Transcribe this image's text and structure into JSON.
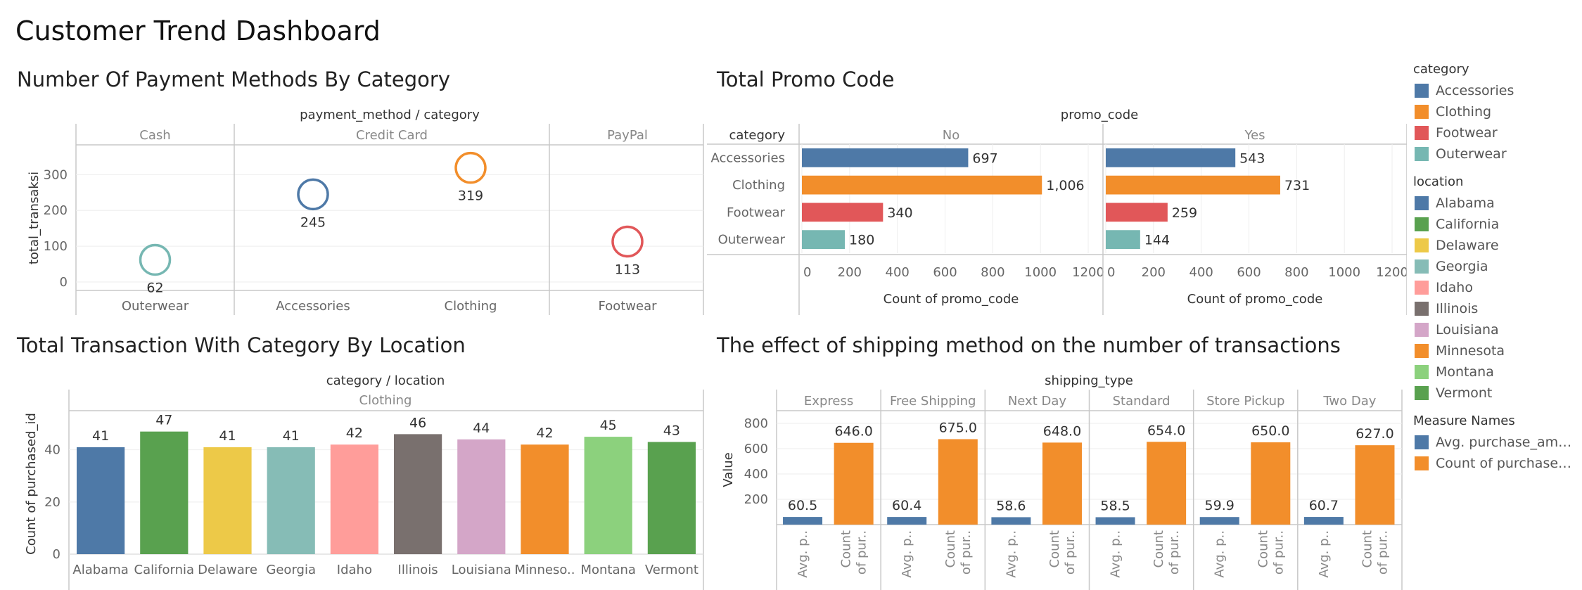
{
  "dashboard": {
    "title": "Customer Trend Dashboard"
  },
  "colors": {
    "Accessories": "#4e79a7",
    "Clothing": "#f28e2b",
    "Footwear": "#e15759",
    "Outerwear": "#76b7b2",
    "Alabama": "#4e79a7",
    "California": "#59a14f",
    "Delaware": "#edc948",
    "Georgia": "#86bcb6",
    "Idaho": "#ff9d9a",
    "Illinois": "#79706e",
    "Louisiana": "#d4a6c8",
    "Minnesota": "#f28e2b",
    "Montana": "#8cd17d",
    "Vermont": "#59a14f",
    "Avg. purchase_amou..": "#4e79a7",
    "Count of purchased_i..": "#f28e2b"
  },
  "chart_data": [
    {
      "type": "scatter",
      "title": "Number Of Payment Methods By Category",
      "header": "payment_method / category",
      "ylabel": "total_transaksi",
      "ylim": [
        0,
        380
      ],
      "yticks": [
        0,
        100,
        200,
        300
      ],
      "panels": [
        {
          "payment_method": "Cash",
          "categories": [
            "Outerwear"
          ],
          "values": [
            62
          ]
        },
        {
          "payment_method": "Credit Card",
          "categories": [
            "Accessories",
            "Clothing"
          ],
          "values": [
            245,
            319
          ]
        },
        {
          "payment_method": "PayPal",
          "categories": [
            "Footwear"
          ],
          "values": [
            113
          ]
        }
      ],
      "grid": true
    },
    {
      "type": "bar",
      "title": "Total Promo Code",
      "header": "promo_code",
      "row_header": "category",
      "categories": [
        "Accessories",
        "Clothing",
        "Footwear",
        "Outerwear"
      ],
      "panels": [
        {
          "name": "No",
          "values": [
            697,
            1006,
            340,
            180
          ],
          "labels": [
            "697",
            "1,006",
            "340",
            "180"
          ]
        },
        {
          "name": "Yes",
          "values": [
            543,
            731,
            259,
            144
          ],
          "labels": [
            "543",
            "731",
            "259",
            "144"
          ]
        }
      ],
      "xlabel": "Count of promo_code",
      "xlim": [
        0,
        1250
      ],
      "xticks": [
        0,
        200,
        400,
        600,
        800,
        1000,
        1200
      ]
    },
    {
      "type": "bar",
      "title": "Total Transaction With Category By Location",
      "header": "category / location",
      "subheader": "Clothing",
      "categories": [
        "Alabama",
        "California",
        "Delaware",
        "Georgia",
        "Idaho",
        "Illinois",
        "Louisiana",
        "Minnesota",
        "Montana",
        "Vermont"
      ],
      "tick_labels": [
        "Alabama",
        "California",
        "Delaware",
        "Georgia",
        "Idaho",
        "Illinois",
        "Louisiana",
        "Minneso..",
        "Montana",
        "Vermont"
      ],
      "values": [
        41,
        47,
        41,
        41,
        42,
        46,
        44,
        42,
        45,
        43
      ],
      "ylabel": "Count of purchased_id",
      "ylim": [
        0,
        55
      ],
      "yticks": [
        0,
        20,
        40
      ]
    },
    {
      "type": "bar",
      "title": "The effect of shipping method on the number of transactions",
      "header": "shipping_type",
      "ylabel": "Value",
      "ylim": [
        0,
        900
      ],
      "yticks": [
        200,
        400,
        600,
        800
      ],
      "panels": [
        "Express",
        "Free Shipping",
        "Next Day",
        "Standard",
        "Store Pickup",
        "Two Day"
      ],
      "measure_tick_labels": [
        [
          "Avg. p.."
        ],
        [
          "Count",
          "of pur.."
        ]
      ],
      "series": [
        {
          "name": "Avg. purchase_amou..",
          "values": [
            60.5,
            60.4,
            58.6,
            58.5,
            59.9,
            60.7
          ],
          "labels": [
            "60.5",
            "60.4",
            "58.6",
            "58.5",
            "59.9",
            "60.7"
          ]
        },
        {
          "name": "Count of purchased_i..",
          "values": [
            646,
            675,
            648,
            654,
            650,
            627
          ],
          "labels": [
            "646.0",
            "675.0",
            "648.0",
            "654.0",
            "650.0",
            "627.0"
          ]
        }
      ]
    }
  ],
  "legend": {
    "groups": [
      {
        "title": "category",
        "items": [
          "Accessories",
          "Clothing",
          "Footwear",
          "Outerwear"
        ]
      },
      {
        "title": "location",
        "items": [
          "Alabama",
          "California",
          "Delaware",
          "Georgia",
          "Idaho",
          "Illinois",
          "Louisiana",
          "Minnesota",
          "Montana",
          "Vermont"
        ]
      },
      {
        "title": "Measure Names",
        "items": [
          "Avg. purchase_amou..",
          "Count of purchased_i.."
        ]
      }
    ]
  }
}
